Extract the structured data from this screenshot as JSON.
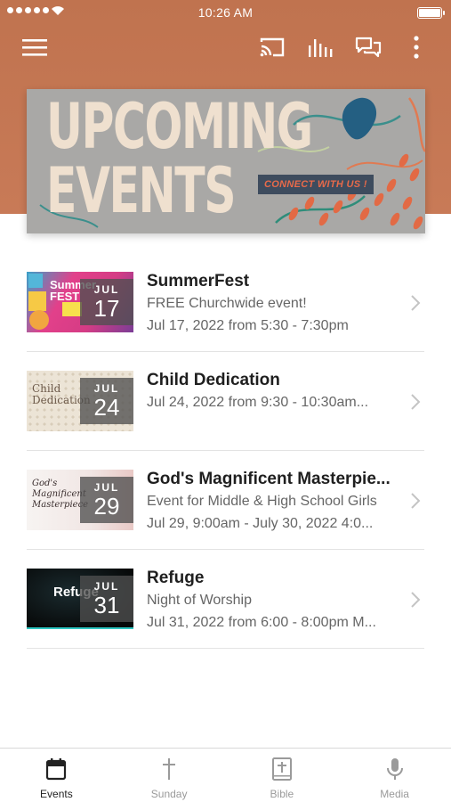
{
  "status_bar": {
    "time": "10:26 AM"
  },
  "colors": {
    "header": "#c0734f",
    "banner_bg": "#a9a8a6",
    "banner_text": "#efe0cf",
    "cta_text": "#e86a4a"
  },
  "app_bar": {
    "icons": [
      "menu-icon",
      "cast-icon",
      "audio-bars-icon",
      "chat-icon",
      "more-vertical-icon"
    ]
  },
  "banner": {
    "title_line1": "UPCOMING",
    "title_line2": "EVENTS",
    "cta": "CONNECT WITH US !"
  },
  "events": [
    {
      "title": "SummerFest",
      "subtitle": "FREE Churchwide event!",
      "date_text": "Jul 17, 2022 from 5:30 - 7:30pm",
      "month": "JUL",
      "day": "17",
      "thumb_text": "Summer FEST"
    },
    {
      "title": "Child Dedication",
      "subtitle": "Jul 24, 2022 from 9:30 - 10:30am...",
      "date_text": "",
      "month": "JUL",
      "day": "24",
      "thumb_text": "Child Dedication"
    },
    {
      "title": "God's Magnificent Masterpie...",
      "subtitle": "Event for Middle & High School Girls",
      "date_text": "Jul 29, 9:00am - July 30, 2022 4:0...",
      "month": "JUL",
      "day": "29",
      "thumb_text": "God's Magnificent Masterpiece"
    },
    {
      "title": "Refuge",
      "subtitle": "Night of Worship",
      "date_text": "Jul 31, 2022 from 6:00 - 8:00pm M...",
      "month": "JUL",
      "day": "31",
      "thumb_text": "Refuge"
    }
  ],
  "tabs": [
    {
      "label": "Events",
      "icon": "calendar-icon",
      "active": true
    },
    {
      "label": "Sunday",
      "icon": "cross-icon",
      "active": false
    },
    {
      "label": "Bible",
      "icon": "bible-icon",
      "active": false
    },
    {
      "label": "Media",
      "icon": "microphone-icon",
      "active": false
    }
  ]
}
